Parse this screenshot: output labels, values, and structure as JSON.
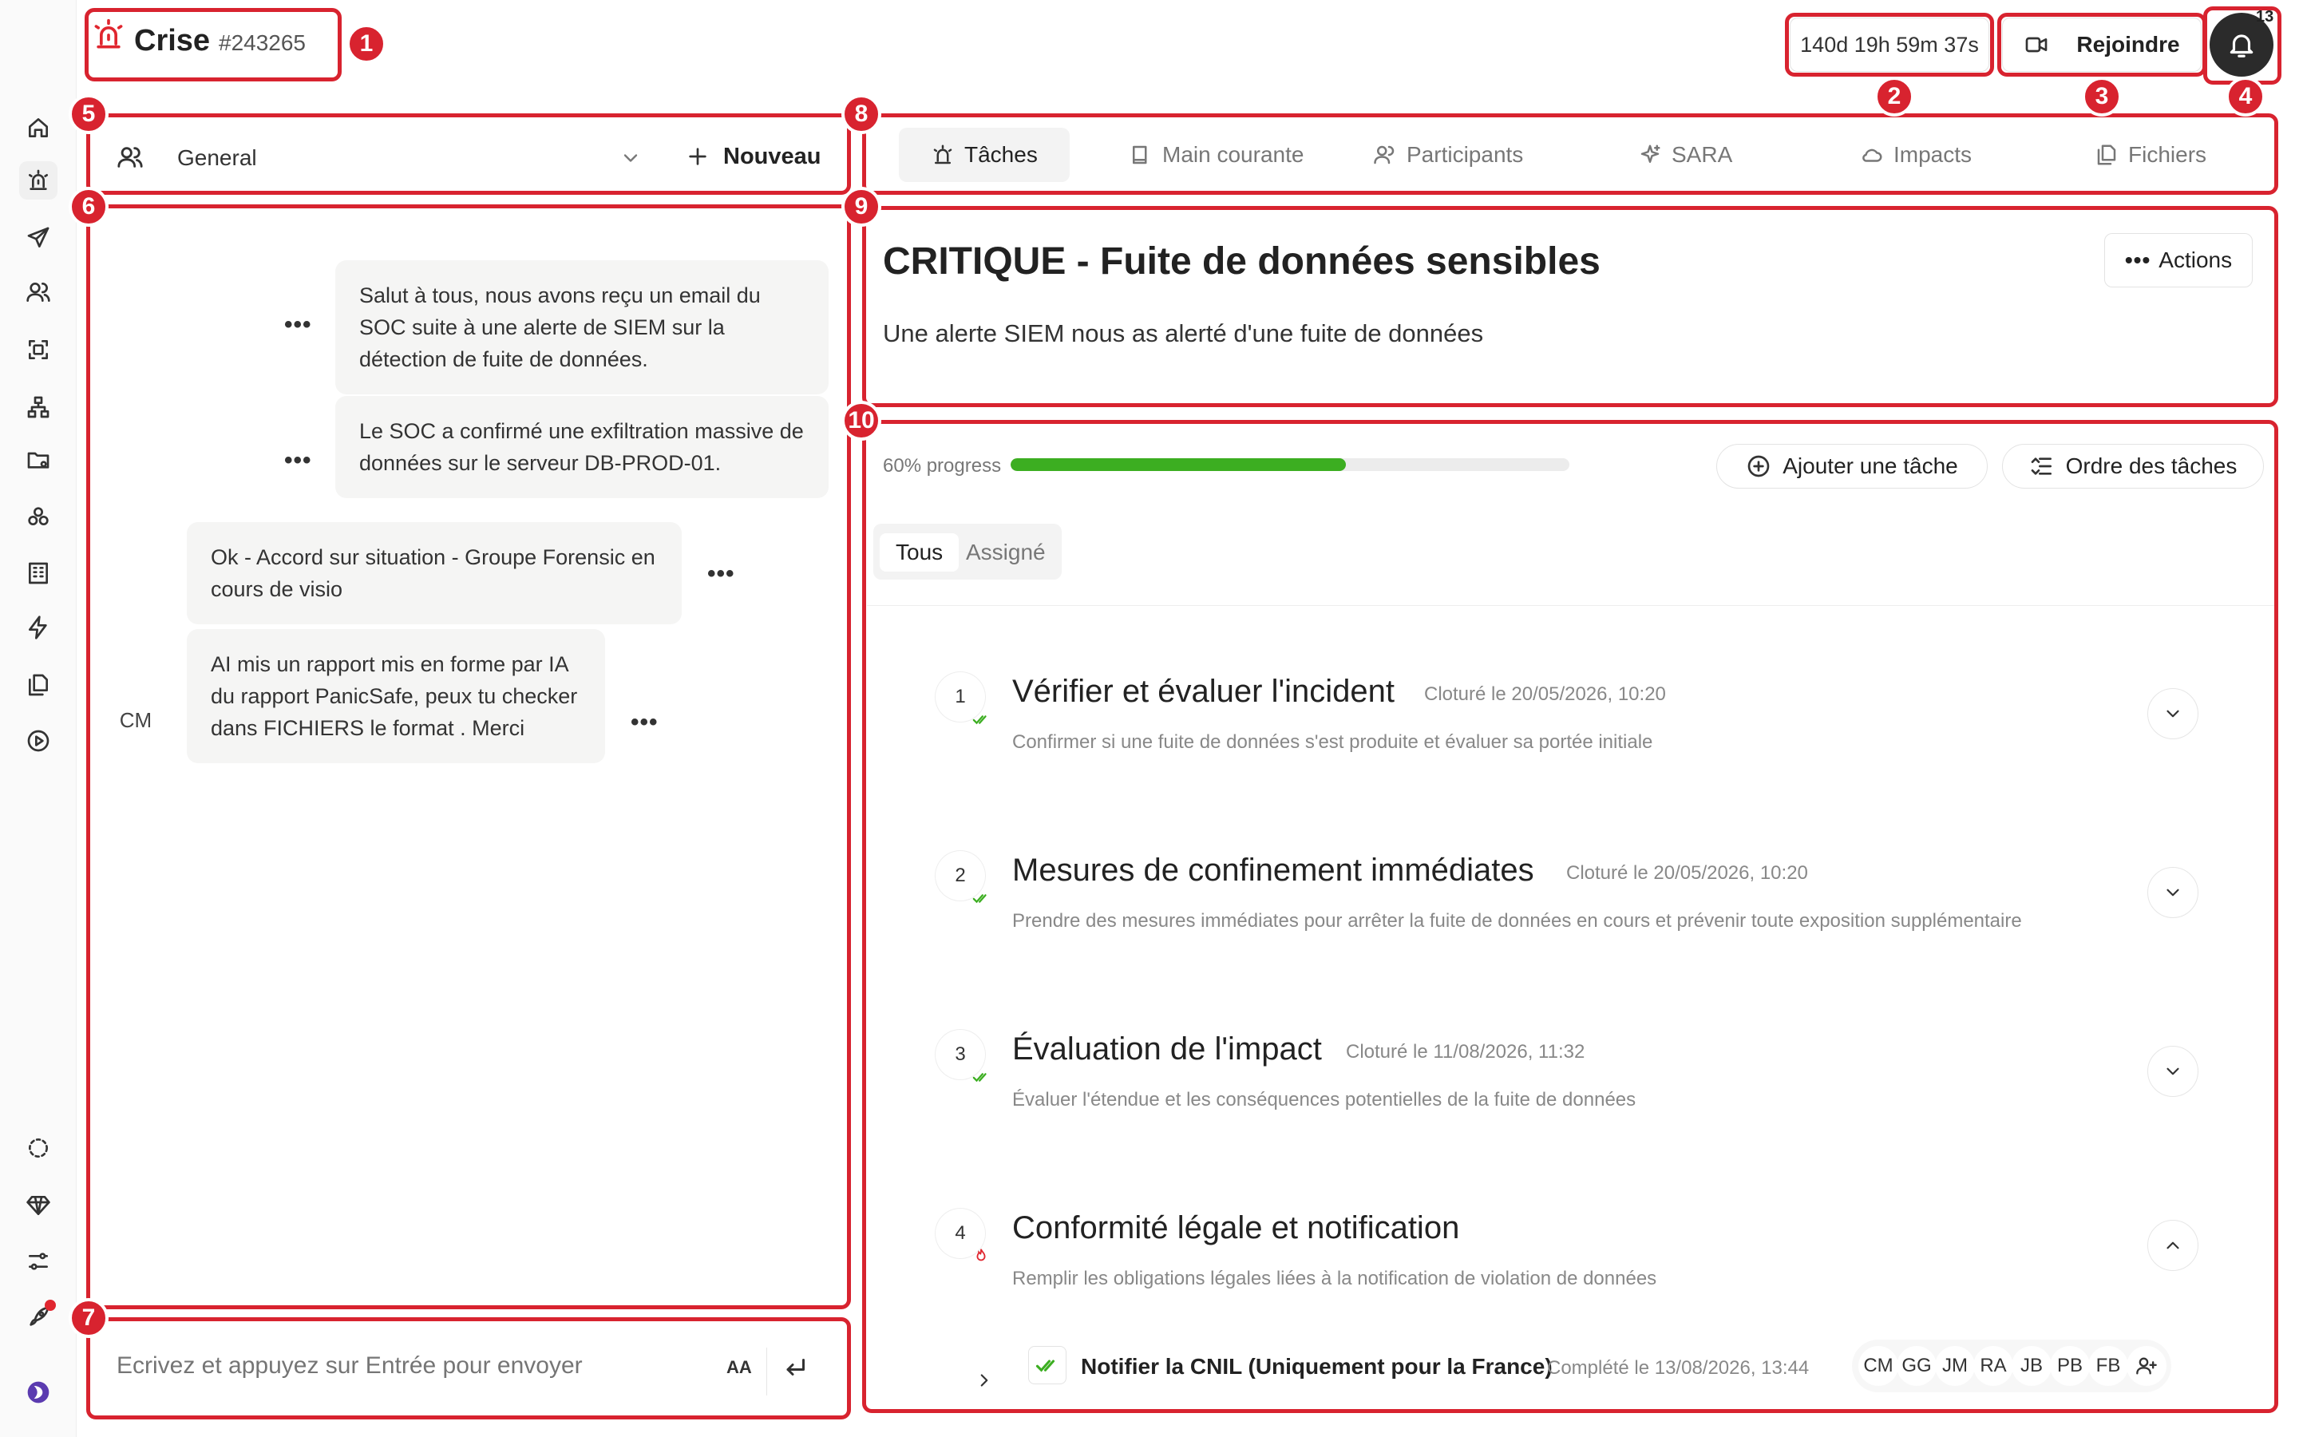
{
  "header": {
    "title": "Crise",
    "crisis_id": "#243265",
    "timer": "140d 19h 59m 37s",
    "join_label": "Rejoindre",
    "notification_count": "13"
  },
  "annotations": [
    "1",
    "2",
    "3",
    "4",
    "5",
    "6",
    "7",
    "8",
    "9",
    "10"
  ],
  "sidebar": {
    "items": [
      {
        "icon": "home-icon"
      },
      {
        "icon": "siren-icon",
        "active": true
      },
      {
        "icon": "send-icon"
      },
      {
        "icon": "users-icon"
      },
      {
        "icon": "scan-icon"
      },
      {
        "icon": "network-icon"
      },
      {
        "icon": "folder-icon"
      },
      {
        "icon": "cluster-icon"
      },
      {
        "icon": "building-icon"
      },
      {
        "icon": "bolt-icon"
      },
      {
        "icon": "files-icon"
      },
      {
        "icon": "play-icon"
      }
    ],
    "bottom_items": [
      {
        "icon": "loader-icon"
      },
      {
        "icon": "gem-icon"
      },
      {
        "icon": "sliders-icon"
      },
      {
        "icon": "rocket-icon"
      },
      {
        "icon": "brand-logo-icon"
      }
    ]
  },
  "chat": {
    "channel": "General",
    "new_label": "Nouveau",
    "messages": [
      {
        "text": "Salut à tous, nous avons reçu un email du SOC suite à une alerte de SIEM sur la détection de fuite de données."
      },
      {
        "text": "Le SOC a confirmé une exfiltration massive de données sur le serveur DB-PROD-01."
      },
      {
        "text": "Ok - Accord sur situation - Groupe Forensic en cours de visio"
      },
      {
        "text": "AI mis un rapport mis en forme par IA du rapport PanicSafe, peux tu checker dans FICHIERS le format . Merci",
        "author": "CM"
      }
    ],
    "input_placeholder": "Ecrivez et appuyez sur Entrée pour envoyer",
    "format_label": "AA"
  },
  "tabs": [
    {
      "label": "Tâches",
      "icon": "siren-icon",
      "active": true
    },
    {
      "label": "Main courante",
      "icon": "book-icon"
    },
    {
      "label": "Participants",
      "icon": "users-icon"
    },
    {
      "label": "SARA",
      "icon": "sparkles-icon"
    },
    {
      "label": "Impacts",
      "icon": "cloud-icon"
    },
    {
      "label": "Fichiers",
      "icon": "files-icon"
    }
  ],
  "crisis": {
    "title": "CRITIQUE - Fuite de données sensibles",
    "description": "Une alerte SIEM nous as alerté d'une fuite de données",
    "actions_label": "Actions"
  },
  "tasks_panel": {
    "progress_label": "60% progress",
    "progress": 0.6,
    "add_task_label": "Ajouter une tâche",
    "order_label": "Ordre des tâches",
    "filters": [
      "Tous",
      "Assigné"
    ],
    "tasks": [
      {
        "num": "1",
        "title": "Vérifier et évaluer l'incident",
        "date": "Cloturé le 20/05/2026, 10:20",
        "desc": "Confirmer si une fuite de données s'est produite et évaluer sa portée initiale",
        "status": "done"
      },
      {
        "num": "2",
        "title": "Mesures de confinement immédiates",
        "date": "Cloturé le 20/05/2026, 10:20",
        "desc": "Prendre des mesures immédiates pour arrêter la fuite de données en cours et prévenir toute exposition supplémentaire",
        "status": "done"
      },
      {
        "num": "3",
        "title": "Évaluation de l'impact",
        "date": "Cloturé le 11/08/2026, 11:32",
        "desc": "Évaluer l'étendue et les conséquences potentielles de la fuite de données",
        "status": "done"
      },
      {
        "num": "4",
        "title": "Conformité légale et notification",
        "date": "",
        "desc": "Remplir les obligations légales liées à la notification de violation de données",
        "status": "in-progress"
      }
    ],
    "subtask": {
      "title": "Notifier la CNIL (Uniquement pour la France)",
      "date": "Complété le 13/08/2026, 13:44",
      "assignees": [
        "CM",
        "GG",
        "JM",
        "RA",
        "JB",
        "PB",
        "FB"
      ]
    }
  },
  "colors": {
    "annotation": "#d8232f",
    "accent_red": "#e0262f",
    "progress": "#3cae21",
    "check": "#3cae21"
  }
}
